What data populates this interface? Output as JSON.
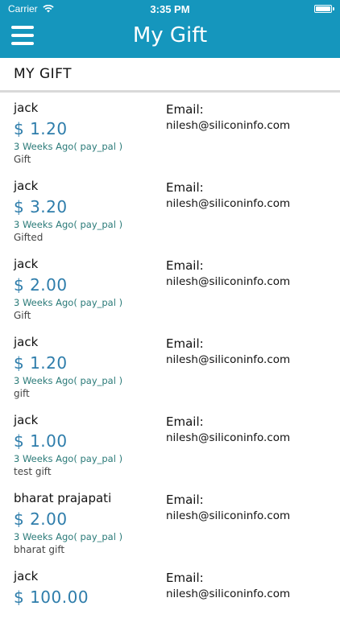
{
  "status_bar": {
    "carrier": "Carrier",
    "time": "3:35 PM"
  },
  "nav": {
    "title": "My Gift"
  },
  "section": {
    "title": "MY GIFT"
  },
  "colors": {
    "accent": "#1596bd",
    "amount": "#2e7dab",
    "date": "#2a7a78"
  },
  "gifts": [
    {
      "name": "jack",
      "amount": "$ 1.20",
      "date": "3 Weeks Ago( pay_pal )",
      "note": "Gift",
      "email_label": "Email:",
      "email": "nilesh@siliconinfo.com"
    },
    {
      "name": "jack",
      "amount": "$ 3.20",
      "date": "3 Weeks Ago( pay_pal )",
      "note": "Gifted",
      "email_label": "Email:",
      "email": "nilesh@siliconinfo.com"
    },
    {
      "name": "jack",
      "amount": "$ 2.00",
      "date": "3 Weeks Ago( pay_pal )",
      "note": "Gift",
      "email_label": "Email:",
      "email": "nilesh@siliconinfo.com"
    },
    {
      "name": "jack",
      "amount": "$ 1.20",
      "date": "3 Weeks Ago( pay_pal )",
      "note": "gift",
      "email_label": "Email:",
      "email": "nilesh@siliconinfo.com"
    },
    {
      "name": "jack",
      "amount": "$ 1.00",
      "date": "3 Weeks Ago( pay_pal )",
      "note": "test gift",
      "email_label": "Email:",
      "email": "nilesh@siliconinfo.com"
    },
    {
      "name": "bharat prajapati",
      "amount": "$ 2.00",
      "date": "3 Weeks Ago( pay_pal )",
      "note": "bharat gift",
      "email_label": "Email:",
      "email": "nilesh@siliconinfo.com"
    },
    {
      "name": "jack",
      "amount": "$ 100.00",
      "date": "",
      "note": "",
      "email_label": "Email:",
      "email": "nilesh@siliconinfo.com"
    }
  ]
}
